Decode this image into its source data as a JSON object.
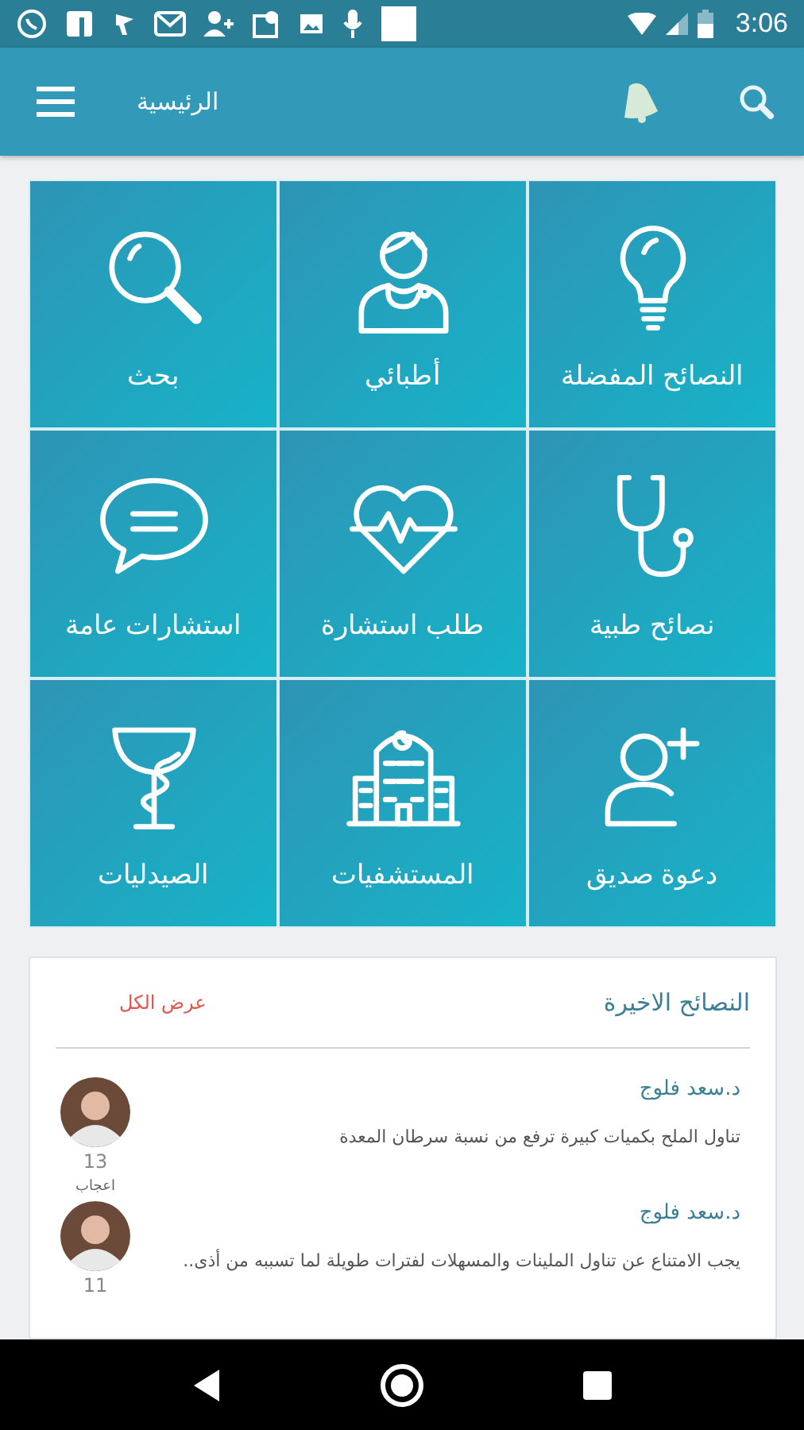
{
  "status_bar": {
    "time": "3:06"
  },
  "app_bar": {
    "title": "الرئيسية"
  },
  "tiles": [
    {
      "label": "النصائح المفضلة",
      "kind": "bulb"
    },
    {
      "label": "أطبائي",
      "kind": "doctor"
    },
    {
      "label": "بحث",
      "kind": "search"
    },
    {
      "label": "نصائح طبية",
      "kind": "stethoscope"
    },
    {
      "label": "طلب استشارة",
      "kind": "heart"
    },
    {
      "label": "استشارات عامة",
      "kind": "chat"
    },
    {
      "label": "دعوة صديق",
      "kind": "user-plus"
    },
    {
      "label": "المستشفيات",
      "kind": "hospital"
    },
    {
      "label": "الصيدليات",
      "kind": "pharmacy"
    }
  ],
  "latest_tips": {
    "title": "النصائح الاخيرة",
    "view_all": "عرض الكل",
    "items": [
      {
        "author": "د.سعد فلوج",
        "text": "تناول الملح بكميات كبيرة ترفع من نسبة سرطان المعدة",
        "likes": "13",
        "likes_label": "اعجاب"
      },
      {
        "author": "د.سعد فلوج",
        "text": "يجب الامتناع عن تناول الملينات والمسهلات لفترات طويلة لما تسببه من أذى..",
        "likes": "11"
      }
    ]
  }
}
